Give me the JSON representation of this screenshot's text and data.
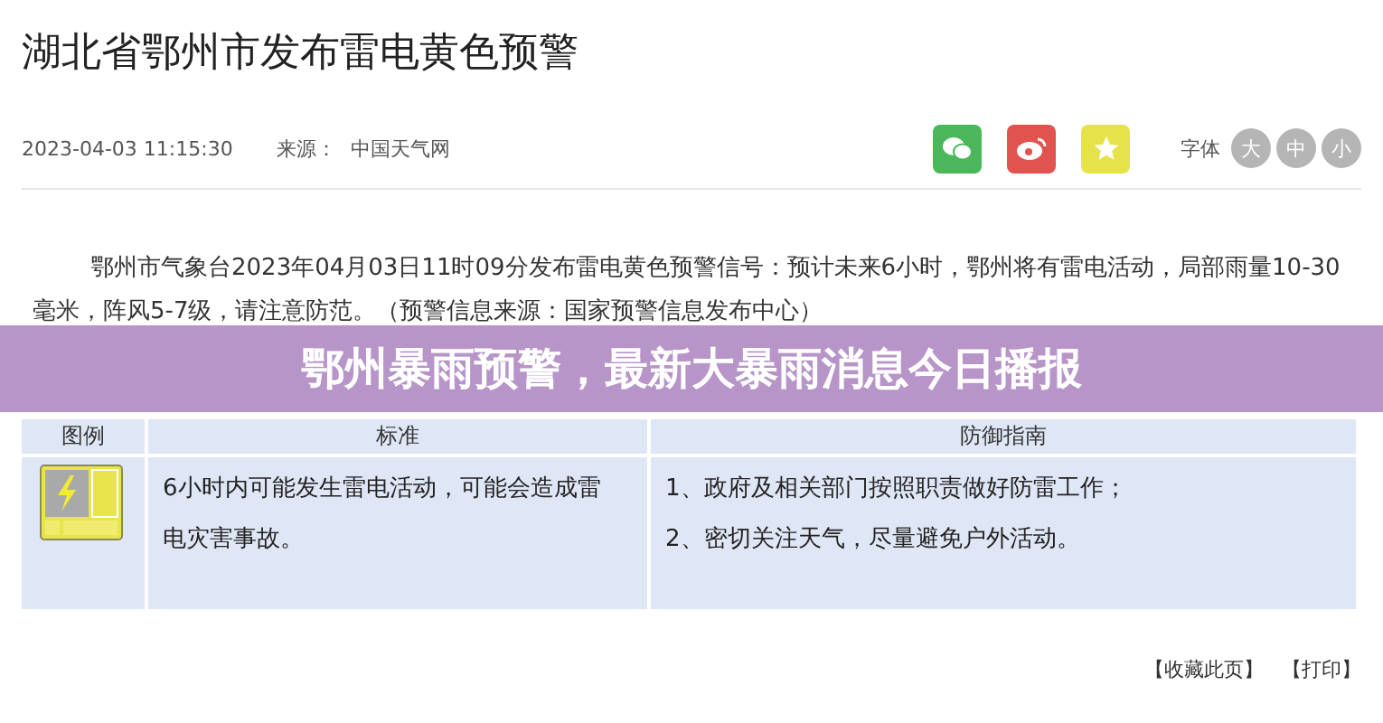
{
  "article": {
    "title": "湖北省鄂州市发布雷电黄色预警",
    "date": "2023-04-03 11:15:30",
    "source_label": "来源：",
    "source": "中国天气网",
    "font_label": "字体",
    "font_sizes": [
      {
        "label": "大"
      },
      {
        "label": "中"
      },
      {
        "label": "小"
      }
    ],
    "share": [
      {
        "kind": "wechat",
        "color": "#4cb65a"
      },
      {
        "kind": "weibo",
        "color": "#e0534f"
      },
      {
        "kind": "favorite",
        "color": "#e6e34a"
      }
    ],
    "body": "鄂州市气象台2023年04月03日11时09分发布雷电黄色预警信号：预计未来6小时，鄂州将有雷电活动，局部雨量10-30毫米，阵风5-7级，请注意防范。（预警信息来源：国家预警信息发布中心）"
  },
  "banner": "鄂州暴雨预警，最新大暴雨消息今日播报",
  "table": {
    "columns": [
      "图例",
      "标准",
      "防御指南"
    ],
    "rows": [
      {
        "kind": "lightning",
        "standard": "6小时内可能发生雷电活动，可能会造成雷电灾害事故。",
        "guide": [
          "1、政府及相关部门按照职责做好防雷工作；",
          "2、密切关注天气，尽量避免户外活动。"
        ]
      }
    ]
  },
  "footer_links": [
    "【收藏此页】",
    "【打印】"
  ]
}
